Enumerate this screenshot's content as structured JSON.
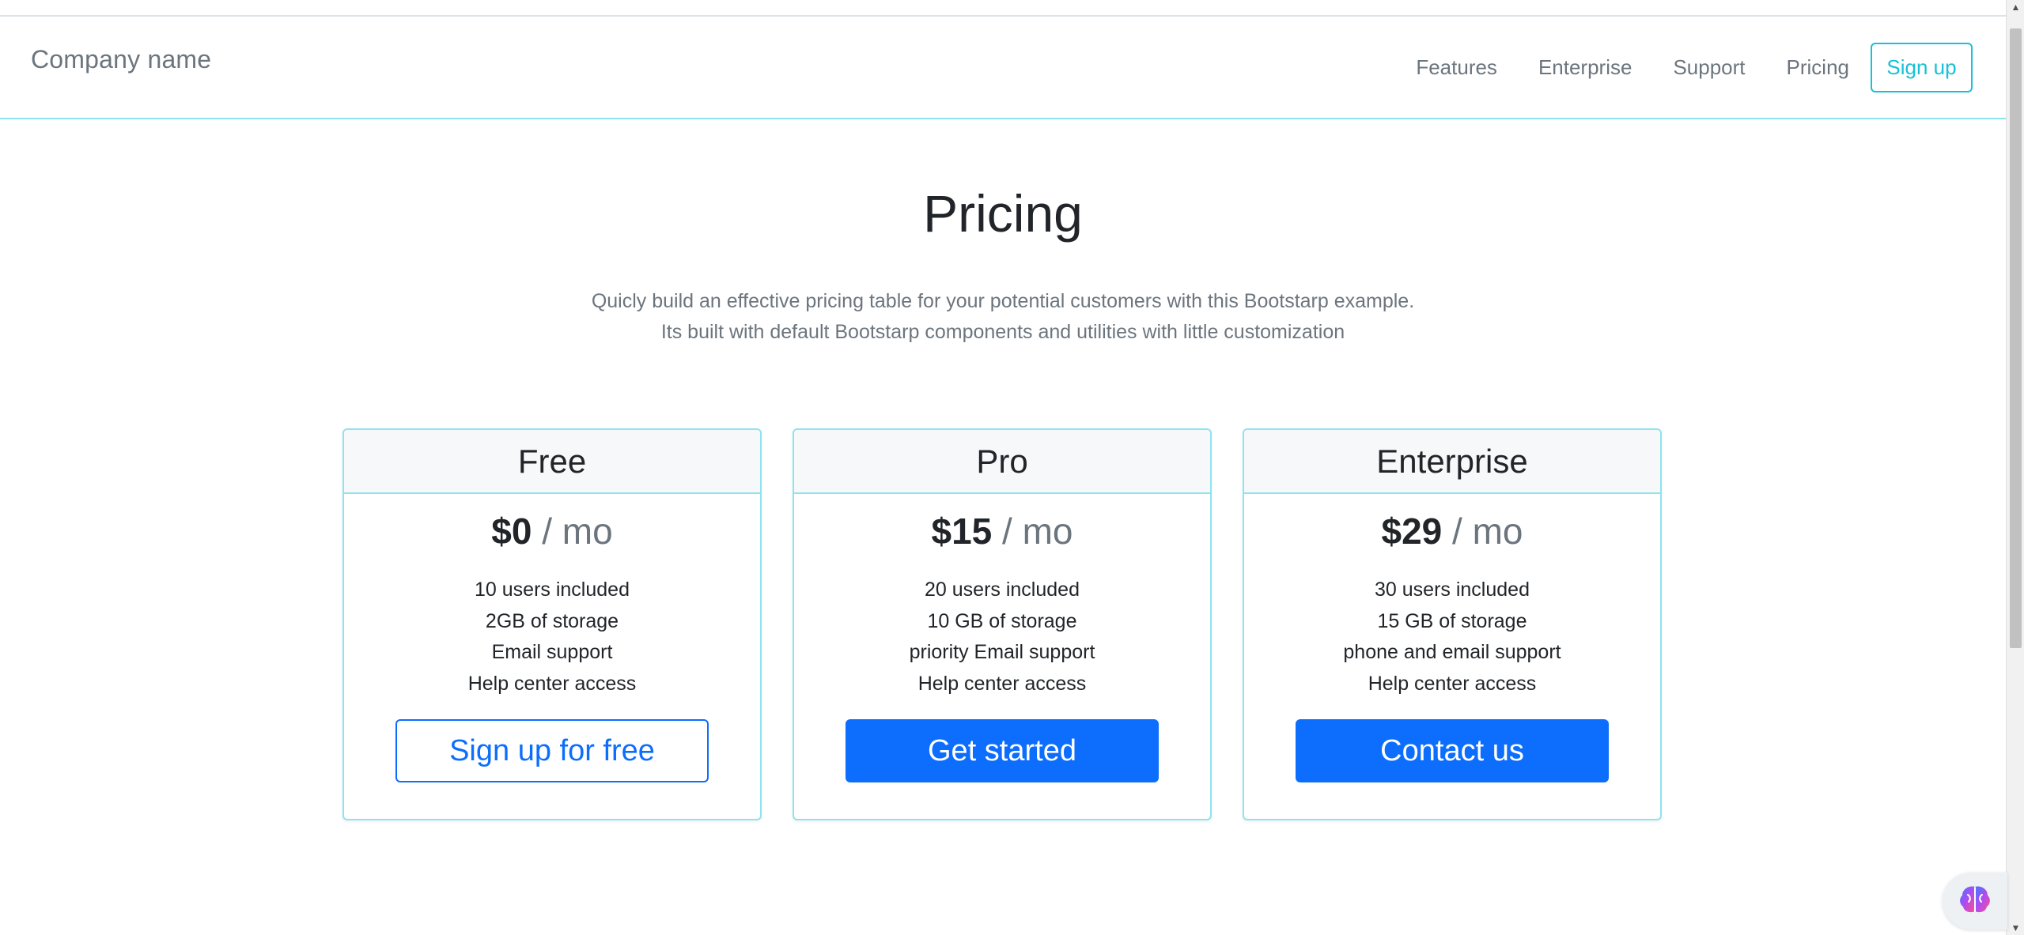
{
  "navbar": {
    "brand": "Company name",
    "links": [
      "Features",
      "Enterprise",
      "Support",
      "Pricing"
    ],
    "signup": "Sign up"
  },
  "hero": {
    "title": "Pricing",
    "lead": "Quicly build an effective pricing table for your potential customers with this Bootstarp example. Its built with default Bootstarp components and utilities with little customization"
  },
  "plans": [
    {
      "name": "Free",
      "price": "$0",
      "period": " / mo",
      "features": [
        "10 users included",
        "2GB of storage",
        "Email support",
        "Help center access"
      ],
      "button": "Sign up for free"
    },
    {
      "name": "Pro",
      "price": "$15",
      "period": " / mo",
      "features": [
        "20 users included",
        "10 GB of storage",
        "priority Email support",
        "Help center access"
      ],
      "button": "Get started"
    },
    {
      "name": "Enterprise",
      "price": "$29",
      "period": " / mo",
      "features": [
        "30 users included",
        "15 GB of storage",
        "phone and email support",
        "Help center access"
      ],
      "button": "Contact us"
    }
  ],
  "colors": {
    "primary": "#0d6efd",
    "accent_border": "#8fe3ee",
    "signup": "#17c1d6",
    "muted": "#6c757d"
  },
  "icons": {
    "assistant": "brain-icon"
  }
}
